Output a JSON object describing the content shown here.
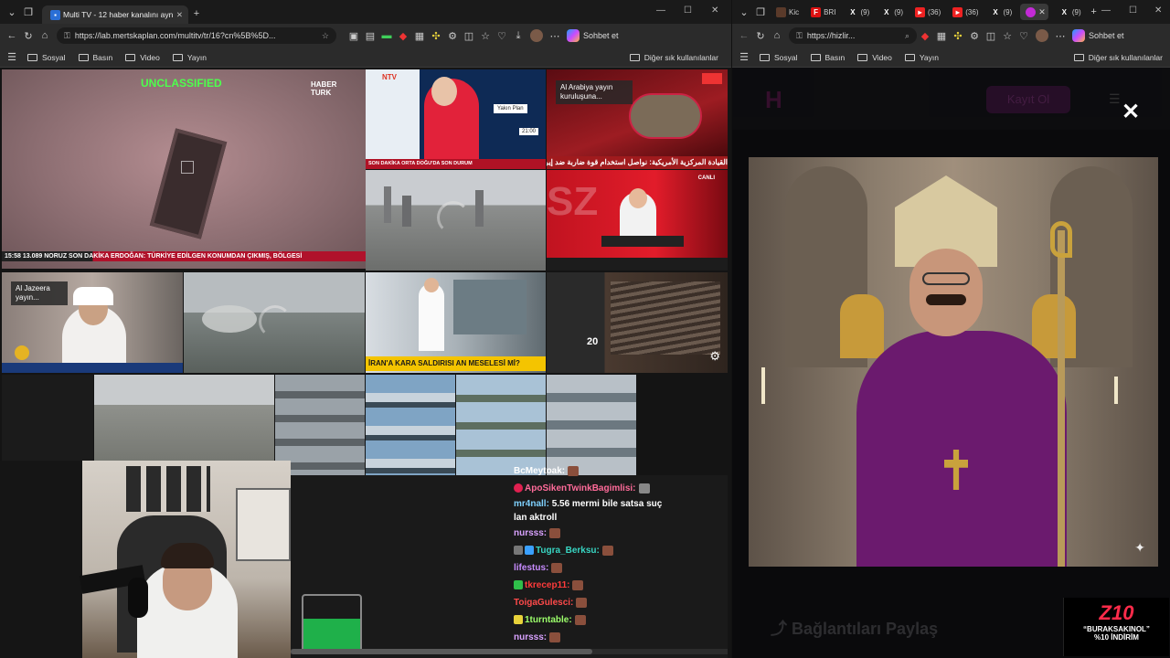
{
  "left": {
    "tab_title": "Multi TV - 12 haber kanalını aynı a",
    "url": "https://lab.mertskaplan.com/multitv/tr/16?cn%5B%5D...",
    "copilot": "Sohbet et",
    "bookmarks": [
      "Sosyal",
      "Basın",
      "Video",
      "Yayın"
    ],
    "other_bookmarks": "Diğer sık kullanılanlar",
    "tiles": {
      "main_label": "UNCLASSIFIED",
      "main_logo": "HABER TURK",
      "main_ticker": "15:58  13.089  NORUZ   SON DAKİKA  ERDOĞAN: TÜRKİYE EDİLGEN KONUMDAN ÇIKMIŞ, BÖLGESİ",
      "ntv_logo": "NTV",
      "ntv_ticker": "SON DAKİKA  ORTA DOĞU'DA SON DURUM",
      "ntv_card": "Yakın Plan",
      "ntv_time": "21:00",
      "alarabiya_badge": "Al Arabiya yayın kuruluşuna...",
      "alarabiya_ticker": "القيادة المركزية الأمريكية: نواصل استخدام قوة ضاربة ضد إيران",
      "aljazeera_badge": "Al Jazeera yayın...",
      "tv100_ticker": "İRAN'A KARA SALDIRISI AN MESELESİ Mİ?",
      "tbmm_number": "20",
      "cnnturk_badge": "CANLI"
    },
    "chat": [
      {
        "user": "BcMeytoak:",
        "color": "#ffffff",
        "text": "",
        "emote": true
      },
      {
        "user": "ApoSikenTwinkBagimlisi:",
        "color": "#ff6b9a",
        "text": "",
        "emote": true
      },
      {
        "user": "mr4nall:",
        "color": "#7fd1ff",
        "text": "5.56 mermi bile satsa suç",
        "emote": false
      },
      {
        "user": "",
        "color": "#ffffff",
        "text": "lan aktroll",
        "emote": false
      },
      {
        "user": "nursss:",
        "color": "#d9a2ff",
        "text": "",
        "emote": true
      },
      {
        "user": "Tugra_Berksu:",
        "color": "#38d6c3",
        "text": "",
        "emote": true
      },
      {
        "user": "lifestus:",
        "color": "#c88cff",
        "text": "",
        "emote": true
      },
      {
        "user": "tkrecep11:",
        "color": "#ff3b3b",
        "text": "",
        "emote": true
      },
      {
        "user": "ToigaGulesci:",
        "color": "#ff4a4a",
        "text": "",
        "emote": true
      },
      {
        "user": "1turntable:",
        "color": "#9cff6b",
        "text": "",
        "emote": true
      },
      {
        "user": "nursss:",
        "color": "#d9a2ff",
        "text": "",
        "emote": true
      }
    ]
  },
  "right": {
    "tabs": [
      "Kic",
      "BRI",
      "(9)",
      "(9)",
      "(36)",
      "(36)",
      "(9)",
      "(9)"
    ],
    "url": "https://hizlir...",
    "copilot": "Sohbet et",
    "bookmarks": [
      "Sosyal",
      "Basın",
      "Video",
      "Yayın"
    ],
    "other_bookmarks": "Diğer sık kullanılanlar",
    "register_button": "Kayıt Ol",
    "close_label": "✕",
    "share_label": "Bağlantıları Paylaş",
    "promo_logo": "Z10",
    "promo_code": "“BURAKSAKINOL”",
    "promo_discount": "%10 İNDİRİM"
  },
  "colors": {
    "accent": "#ff2b6a",
    "browser_bg": "#202020",
    "purple_robe": "#6b1a6e",
    "gold": "#c9a23c"
  }
}
